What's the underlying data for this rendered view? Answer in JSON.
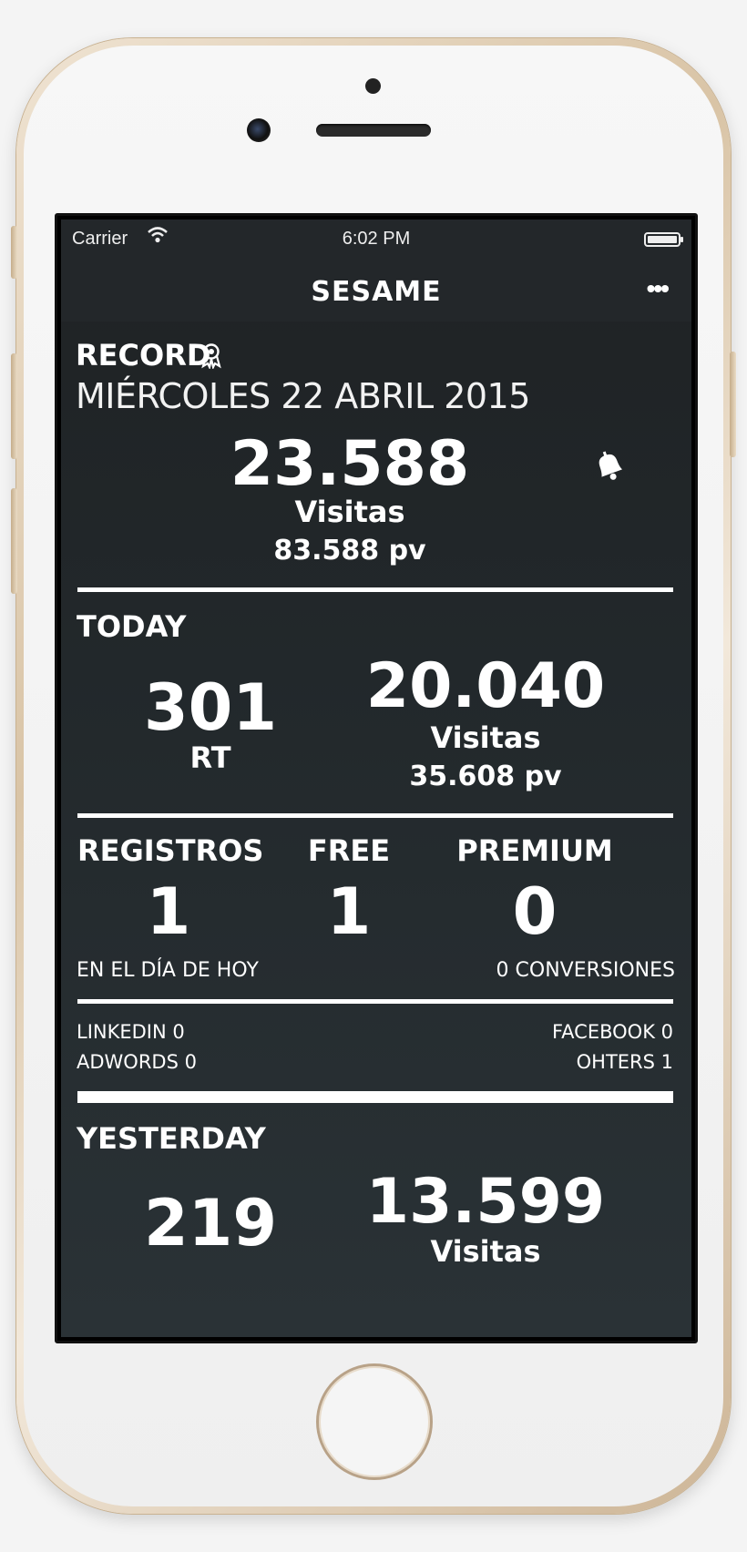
{
  "status_bar": {
    "carrier": "Carrier",
    "time": "6:02 PM"
  },
  "nav": {
    "title": "SESAME",
    "more_label": "•••"
  },
  "record": {
    "label": "RECORD",
    "date": "MIÉRCOLES 22 ABRIL 2015",
    "visits_value": "23.588",
    "visits_label": "Visitas",
    "pv": "83.588 pv"
  },
  "today": {
    "label": "TODAY",
    "rt_value": "301",
    "rt_label": "RT",
    "visits_value": "20.040",
    "visits_label": "Visitas",
    "pv": "35.608 pv"
  },
  "registrations": {
    "registros_label": "REGISTROS",
    "free_label": "FREE",
    "premium_label": "PREMIUM",
    "registros_value": "1",
    "free_value": "1",
    "premium_value": "0",
    "day_note": "EN EL DÍA DE HOY",
    "conversions": "0 CONVERSIONES"
  },
  "sources": {
    "linkedin": "LINKEDIN 0",
    "adwords": "ADWORDS 0",
    "facebook": "FACEBOOK 0",
    "others": "OHTERS 1"
  },
  "yesterday": {
    "label": "YESTERDAY",
    "rt_value": "219",
    "visits_value": "13.599",
    "visits_label": "Visitas"
  }
}
